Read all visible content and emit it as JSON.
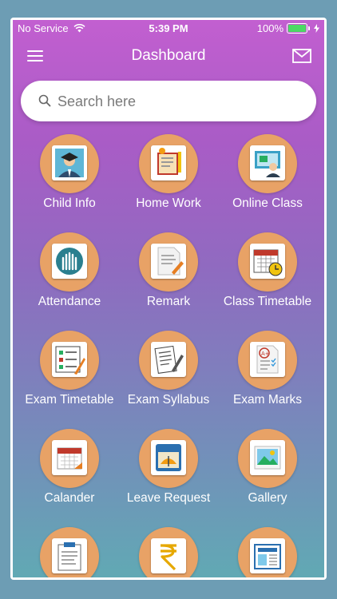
{
  "status_bar": {
    "carrier": "No Service",
    "time": "5:39 PM",
    "battery": "100%"
  },
  "navbar": {
    "title": "Dashboard",
    "menu_icon": "hamburger-menu-icon",
    "mail_icon": "mail-icon"
  },
  "search": {
    "placeholder": "Search here",
    "icon": "search-icon"
  },
  "tiles": [
    {
      "label": "Child Info",
      "icon": "student-graduate-icon"
    },
    {
      "label": "Home Work",
      "icon": "homework-notebook-icon"
    },
    {
      "label": "Online Class",
      "icon": "online-class-icon"
    },
    {
      "label": "Attendance",
      "icon": "raised-hands-icon"
    },
    {
      "label": "Remark",
      "icon": "remark-note-icon"
    },
    {
      "label": "Class Timetable",
      "icon": "timetable-calendar-clock-icon"
    },
    {
      "label": "Exam Timetable",
      "icon": "exam-checklist-icon"
    },
    {
      "label": "Exam Syllabus",
      "icon": "syllabus-document-icon"
    },
    {
      "label": "Exam Marks",
      "icon": "exam-marks-grade-icon"
    },
    {
      "label": "Calander",
      "icon": "calendar-icon"
    },
    {
      "label": "Leave Request",
      "icon": "leave-request-icon"
    },
    {
      "label": "Gallery",
      "icon": "gallery-image-icon"
    },
    {
      "label": "",
      "icon": "clipboard-icon"
    },
    {
      "label": "",
      "icon": "rupee-fee-icon"
    },
    {
      "label": "",
      "icon": "newspaper-icon"
    }
  ],
  "colors": {
    "tile_circle": "#e8a266",
    "gradient_top": "#c25fd0",
    "gradient_bottom": "#61a9b4"
  }
}
